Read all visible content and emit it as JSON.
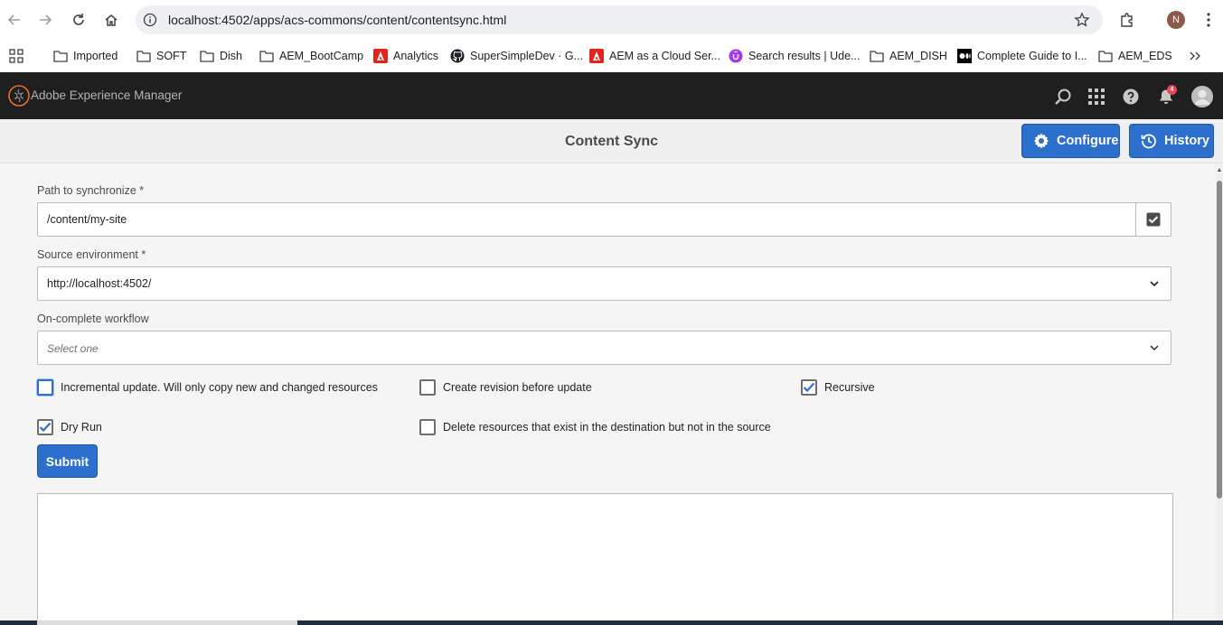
{
  "browser": {
    "url": "localhost:4502/apps/acs-commons/content/contentsync.html",
    "profile_initial": "N",
    "bookmarks": [
      {
        "label": "Imported",
        "icon": "folder-icon"
      },
      {
        "label": "SOFT",
        "icon": "folder-icon"
      },
      {
        "label": "Dish",
        "icon": "folder-icon"
      },
      {
        "label": "AEM_BootCamp",
        "icon": "folder-icon"
      },
      {
        "label": "Analytics",
        "icon": "adobe-icon"
      },
      {
        "label": "SuperSimpleDev · G...",
        "icon": "github-icon"
      },
      {
        "label": "AEM as a Cloud Ser...",
        "icon": "adobe-icon"
      },
      {
        "label": "Search results | Ude...",
        "icon": "udemy-icon"
      },
      {
        "label": "AEM_DISH",
        "icon": "folder-icon"
      },
      {
        "label": "Complete Guide to I...",
        "icon": "medium-icon"
      },
      {
        "label": "AEM_EDS",
        "icon": "folder-icon"
      }
    ]
  },
  "aem": {
    "title": "Adobe Experience Manager",
    "notification_count": "4"
  },
  "page": {
    "title": "Content Sync",
    "configure_label": "Configure",
    "history_label": "History"
  },
  "form": {
    "path_label": "Path to synchronize *",
    "path_value": "/content/my-site",
    "source_label": "Source environment *",
    "source_value": "http://localhost:4502/",
    "workflow_label": "On-complete workflow",
    "workflow_placeholder": "Select one",
    "checkboxes": {
      "incremental": {
        "label": "Incremental update. Will only copy new and changed resources",
        "checked": false
      },
      "revision": {
        "label": "Create revision before update",
        "checked": false
      },
      "recursive": {
        "label": "Recursive",
        "checked": true
      },
      "dry_run": {
        "label": "Dry Run",
        "checked": true
      },
      "delete": {
        "label": "Delete resources that exist in the destination but not in the source",
        "checked": false
      }
    },
    "submit_label": "Submit"
  },
  "colors": {
    "primary": "#2c6fcc",
    "header_bg": "#1f1f1f",
    "badge": "#e34850"
  }
}
